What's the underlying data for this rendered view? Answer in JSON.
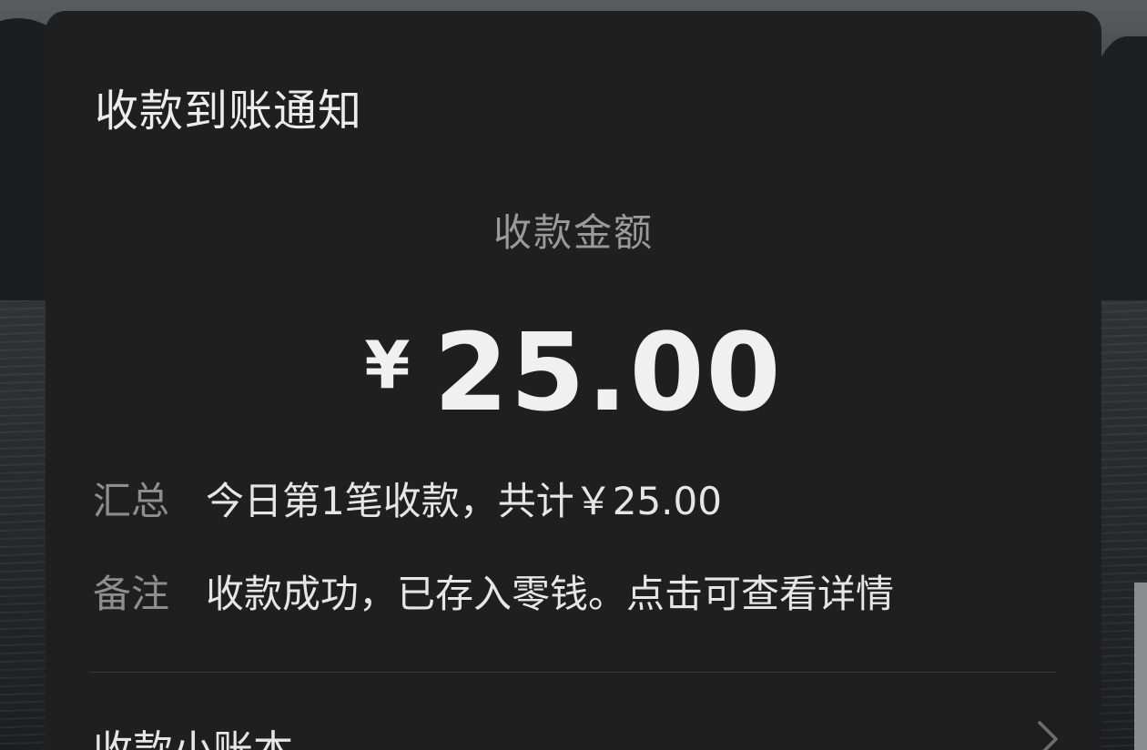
{
  "card": {
    "title": "收款到账通知",
    "amount_label": "收款金额",
    "currency_symbol": "¥",
    "amount_value": "25.00",
    "summary_key": "汇总",
    "summary_value": "今日第1笔收款，共计￥25.00",
    "remark_key": "备注",
    "remark_value": "收款成功，已存入零钱。点击可查看详情",
    "ledger_label": "收款小账本",
    "ledger_icon": "chevron-right-icon"
  },
  "colors": {
    "card_background": "#1f1f1f",
    "primary_text": "#e6e6e6",
    "secondary_text": "#8e8e8e"
  }
}
